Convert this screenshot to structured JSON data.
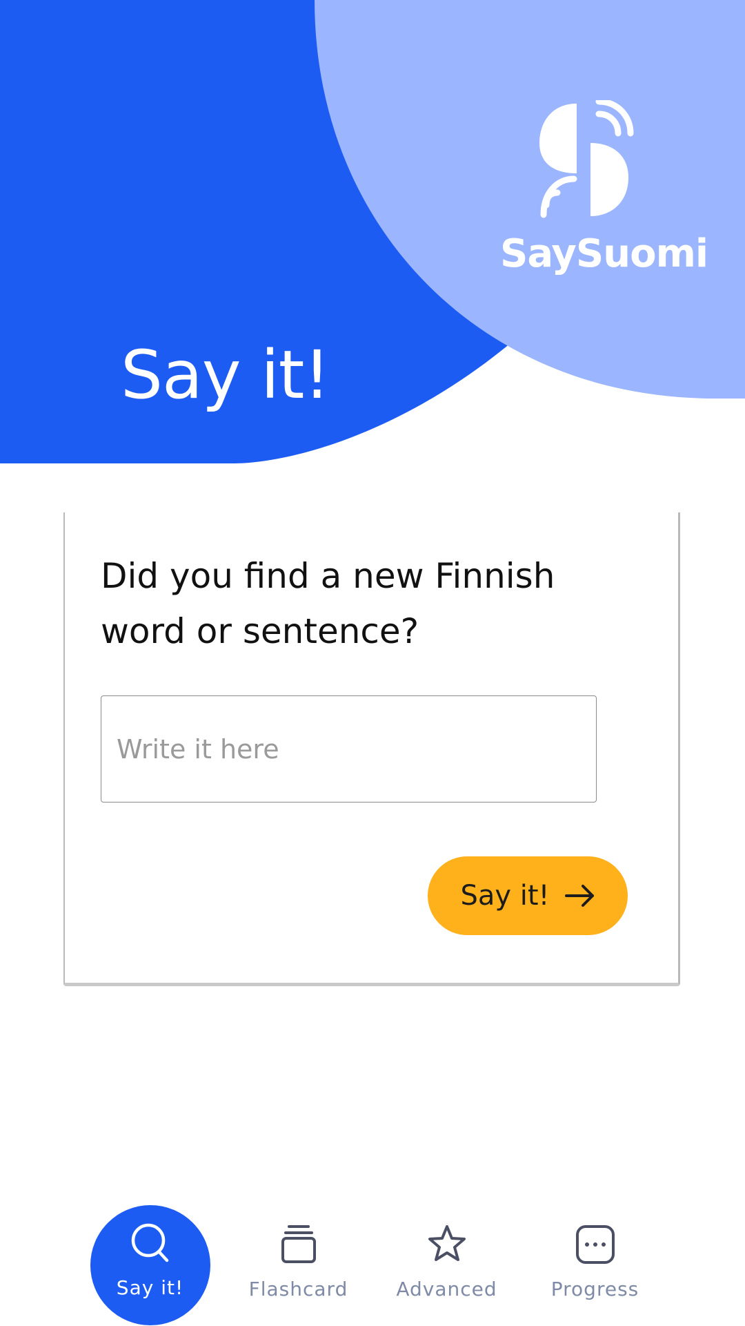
{
  "colors": {
    "primary_blue": "#1d5cf3",
    "light_blue": "#9bb5ff",
    "accent_yellow": "#ffb11b",
    "nav_inactive": "#7e8aa6",
    "text_dark": "#111111"
  },
  "header": {
    "title": "Say it!",
    "brand_name": "SaySuomi",
    "brand_icon": "saysuomi-logo-icon"
  },
  "card": {
    "prompt": "Did you find a new Finnish word or sentence?",
    "input": {
      "value": "",
      "placeholder": "Write it here"
    },
    "submit": {
      "label": "Say it!",
      "icon": "arrow-right-icon"
    }
  },
  "bottom_nav": {
    "active_index": 0,
    "items": [
      {
        "label": "Say it!",
        "icon": "search-icon"
      },
      {
        "label": "Flashcard",
        "icon": "flashcard-stack-icon"
      },
      {
        "label": "Advanced",
        "icon": "star-icon"
      },
      {
        "label": "Progress",
        "icon": "chat-dots-icon"
      }
    ]
  }
}
